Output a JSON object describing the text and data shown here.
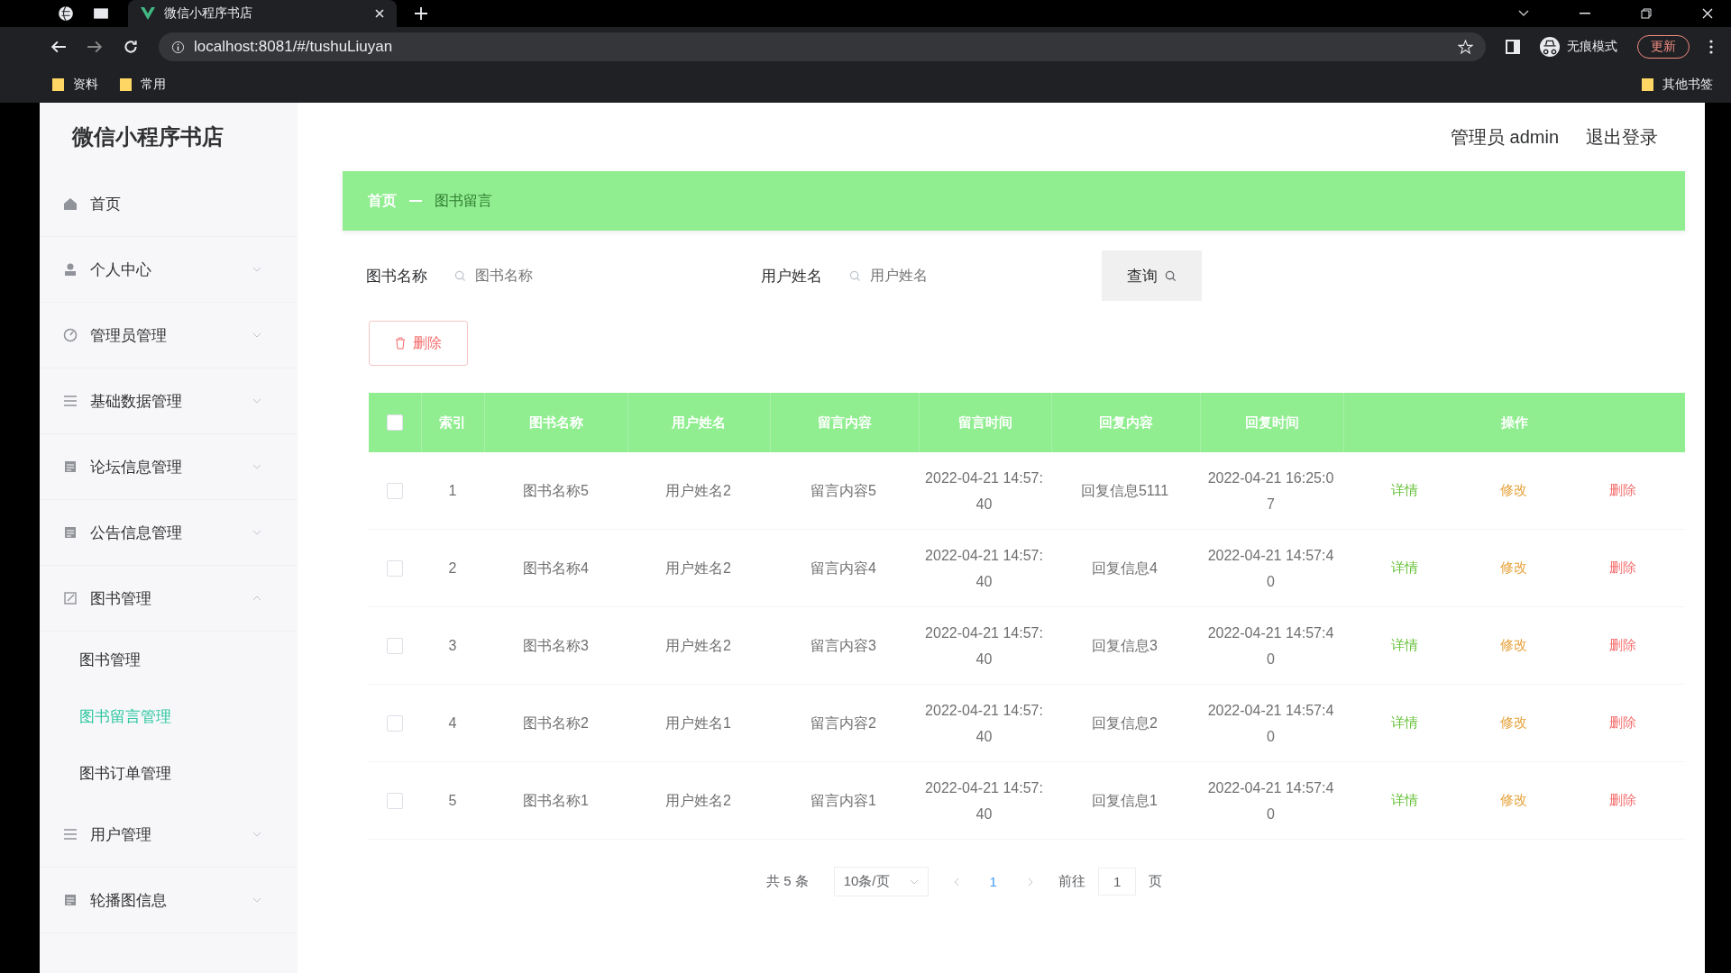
{
  "browser": {
    "tab_title": "微信小程序书店",
    "url": "localhost:8081/#/tushuLiuyan",
    "bookmarks": [
      "资料",
      "常用"
    ],
    "other_bookmarks": "其他书签",
    "incognito": "无痕模式",
    "update": "更新"
  },
  "header": {
    "title": "微信小程序书店",
    "user": "管理员 admin",
    "logout": "退出登录"
  },
  "sidebar": {
    "items": [
      {
        "label": "首页",
        "has_children": false
      },
      {
        "label": "个人中心",
        "has_children": true,
        "expanded": false
      },
      {
        "label": "管理员管理",
        "has_children": true,
        "expanded": false
      },
      {
        "label": "基础数据管理",
        "has_children": true,
        "expanded": false
      },
      {
        "label": "论坛信息管理",
        "has_children": true,
        "expanded": false
      },
      {
        "label": "公告信息管理",
        "has_children": true,
        "expanded": false
      },
      {
        "label": "图书管理",
        "has_children": true,
        "expanded": true,
        "children": [
          {
            "label": "图书管理",
            "selected": false
          },
          {
            "label": "图书留言管理",
            "selected": true
          },
          {
            "label": "图书订单管理",
            "selected": false
          }
        ]
      },
      {
        "label": "用户管理",
        "has_children": true,
        "expanded": false
      },
      {
        "label": "轮播图信息",
        "has_children": true,
        "expanded": false
      }
    ]
  },
  "breadcrumb": [
    "首页",
    "图书留言"
  ],
  "search": {
    "fields": [
      {
        "label": "图书名称",
        "placeholder": "图书名称"
      },
      {
        "label": "用户姓名",
        "placeholder": "用户姓名"
      }
    ],
    "button": "查询"
  },
  "delete_button": "删除",
  "table": {
    "all_selected": false,
    "columns": [
      "索引",
      "图书名称",
      "用户姓名",
      "留言内容",
      "留言时间",
      "回复内容",
      "回复时间",
      "操作"
    ],
    "rows": [
      {
        "selected": false,
        "cells": [
          "1",
          "图书名称5",
          "用户姓名2",
          "留言内容5",
          "2022-04-21 14:57:40",
          "回复信息5111",
          "2022-04-21 16:25:07"
        ],
        "actions": [
          {
            "kind": "detail",
            "label": "详情"
          },
          {
            "kind": "edit",
            "label": "修改"
          },
          {
            "kind": "delete",
            "label": "删除"
          }
        ]
      },
      {
        "selected": false,
        "cells": [
          "2",
          "图书名称4",
          "用户姓名2",
          "留言内容4",
          "2022-04-21 14:57:40",
          "回复信息4",
          "2022-04-21 14:57:40"
        ],
        "actions": [
          {
            "kind": "detail",
            "label": "详情"
          },
          {
            "kind": "edit",
            "label": "修改"
          },
          {
            "kind": "delete",
            "label": "删除"
          }
        ]
      },
      {
        "selected": false,
        "cells": [
          "3",
          "图书名称3",
          "用户姓名2",
          "留言内容3",
          "2022-04-21 14:57:40",
          "回复信息3",
          "2022-04-21 14:57:40"
        ],
        "actions": [
          {
            "kind": "detail",
            "label": "详情"
          },
          {
            "kind": "edit",
            "label": "修改"
          },
          {
            "kind": "delete",
            "label": "删除"
          }
        ]
      },
      {
        "selected": false,
        "cells": [
          "4",
          "图书名称2",
          "用户姓名1",
          "留言内容2",
          "2022-04-21 14:57:40",
          "回复信息2",
          "2022-04-21 14:57:40"
        ],
        "actions": [
          {
            "kind": "detail",
            "label": "详情"
          },
          {
            "kind": "edit",
            "label": "修改"
          },
          {
            "kind": "delete",
            "label": "删除"
          }
        ]
      },
      {
        "selected": false,
        "cells": [
          "5",
          "图书名称1",
          "用户姓名2",
          "留言内容1",
          "2022-04-21 14:57:40",
          "回复信息1",
          "2022-04-21 14:57:40"
        ],
        "actions": [
          {
            "kind": "detail",
            "label": "详情"
          },
          {
            "kind": "edit",
            "label": "修改"
          },
          {
            "kind": "delete",
            "label": "删除"
          }
        ]
      }
    ]
  },
  "pagination": {
    "total": "共 5 条",
    "page_size": "10条/页",
    "pages": [
      {
        "label": "1",
        "selected": true
      }
    ],
    "goto_label": "前往",
    "goto_value": "1",
    "goto_suffix": "页"
  }
}
